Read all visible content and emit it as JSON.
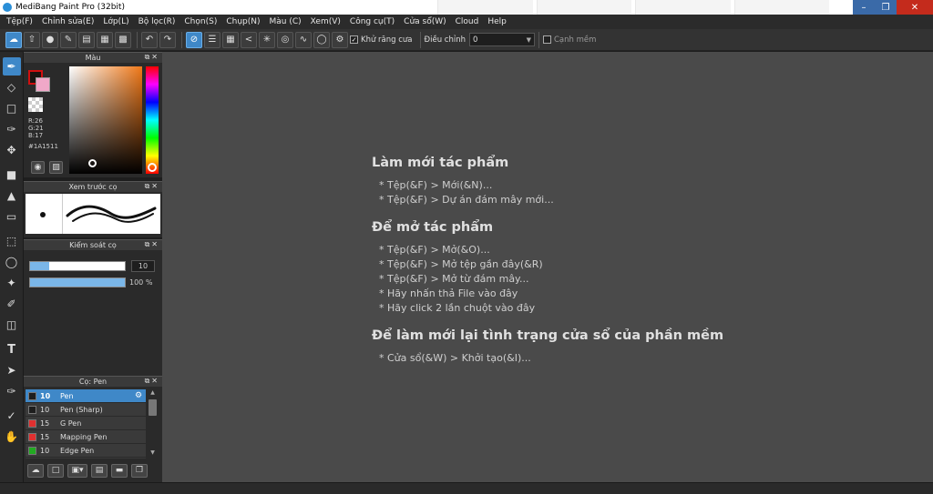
{
  "window": {
    "title": "MediBang Paint Pro (32bit)"
  },
  "menubar": [
    "Tệp(F)",
    "Chỉnh sửa(E)",
    "Lớp(L)",
    "Bộ lọc(R)",
    "Chọn(S)",
    "Chụp(N)",
    "Màu (C)",
    "Xem(V)",
    "Công cụ(T)",
    "Cửa sổ(W)",
    "Cloud",
    "Help"
  ],
  "toolbar": {
    "antialias_label": "Khử răng cưa",
    "correction_label": "Điều chỉnh",
    "correction_value": "0",
    "edge_label": "Cạnh mềm"
  },
  "panels": {
    "color": {
      "title": "Màu",
      "r": "R:26",
      "g": "G:21",
      "b": "B:17",
      "hex": "#1A1511",
      "fg_color": "#1A1511",
      "bg_color": "#F0A8C8"
    },
    "brush_preview": {
      "title": "Xem trước cọ"
    },
    "brush_control": {
      "title": "Kiểm soát cọ",
      "size_value": "10",
      "size_fraction": 0.2,
      "opacity_value": "100 %",
      "opacity_fraction": 1.0
    },
    "brush_list": {
      "title": "Cọ: Pen",
      "items": [
        {
          "size": "10",
          "name": "Pen",
          "color": "#1e1e1e",
          "selected": true
        },
        {
          "size": "10",
          "name": "Pen (Sharp)",
          "color": "#1e1e1e",
          "selected": false
        },
        {
          "size": "15",
          "name": "G Pen",
          "color": "#e03030",
          "selected": false
        },
        {
          "size": "15",
          "name": "Mapping Pen",
          "color": "#e03030",
          "selected": false
        },
        {
          "size": "10",
          "name": "Edge Pen",
          "color": "#22aa22",
          "selected": false
        }
      ]
    }
  },
  "welcome": {
    "sections": [
      {
        "heading": "Làm mới tác phẩm",
        "items": [
          "* Tệp(&F) > Mới(&N)...",
          "* Tệp(&F) > Dự án đám mây mới..."
        ]
      },
      {
        "heading": "Để mở tác phẩm",
        "items": [
          "* Tệp(&F) > Mở(&O)...",
          "* Tệp(&F) > Mở tệp gần đây(&R)",
          "* Tệp(&F) > Mở từ đám mây...",
          "* Hãy nhấn thả File vào đây",
          "* Hãy click 2 lần chuột vào đây"
        ]
      },
      {
        "heading": "Để làm mới lại tình trạng cửa sổ của phần mềm",
        "items": [
          "* Cửa sổ(&W) > Khởi tạo(&I)..."
        ]
      }
    ]
  },
  "icons": {
    "tools": [
      "brush-icon",
      "eraser-icon",
      "rect-icon",
      "edit-icon",
      "move-icon",
      "fill-rect-icon",
      "bucket-icon",
      "gradient-icon",
      "select-rect-icon",
      "lasso-icon",
      "magic-wand-icon",
      "select-pen-icon",
      "select-eraser-icon",
      "text-icon",
      "operation-icon",
      "eyedropper-icon",
      "dropper-icon",
      "hand-icon"
    ]
  }
}
